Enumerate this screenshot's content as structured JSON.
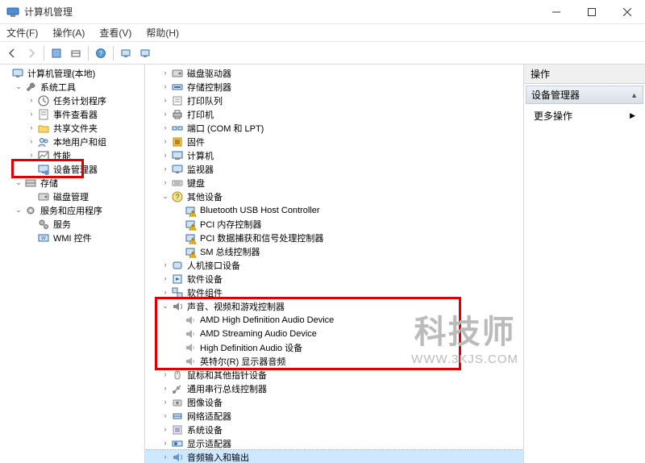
{
  "window": {
    "title": "计算机管理"
  },
  "menubar": [
    "文件(F)",
    "操作(A)",
    "查看(V)",
    "帮助(H)"
  ],
  "left_tree": [
    {
      "d": 0,
      "ex": "",
      "icon": "monitor",
      "label": "计算机管理(本地)"
    },
    {
      "d": 1,
      "ex": "v",
      "icon": "wrench",
      "label": "系统工具"
    },
    {
      "d": 2,
      "ex": ">",
      "icon": "clock",
      "label": "任务计划程序"
    },
    {
      "d": 2,
      "ex": ">",
      "icon": "event",
      "label": "事件查看器"
    },
    {
      "d": 2,
      "ex": ">",
      "icon": "folder",
      "label": "共享文件夹"
    },
    {
      "d": 2,
      "ex": ">",
      "icon": "users",
      "label": "本地用户和组"
    },
    {
      "d": 2,
      "ex": ">",
      "icon": "perf",
      "label": "性能"
    },
    {
      "d": 2,
      "ex": "",
      "icon": "device",
      "label": "设备管理器",
      "boxed": true
    },
    {
      "d": 1,
      "ex": "v",
      "icon": "storage",
      "label": "存储"
    },
    {
      "d": 2,
      "ex": "",
      "icon": "disk",
      "label": "磁盘管理"
    },
    {
      "d": 1,
      "ex": "v",
      "icon": "gear",
      "label": "服务和应用程序"
    },
    {
      "d": 2,
      "ex": "",
      "icon": "gear2",
      "label": "服务"
    },
    {
      "d": 2,
      "ex": "",
      "icon": "wmi",
      "label": "WMI 控件"
    }
  ],
  "device_tree": [
    {
      "d": 0,
      "ex": ">",
      "icon": "disk",
      "label": "磁盘驱动器"
    },
    {
      "d": 0,
      "ex": ">",
      "icon": "scsi",
      "label": "存储控制器"
    },
    {
      "d": 0,
      "ex": ">",
      "icon": "queue",
      "label": "打印队列"
    },
    {
      "d": 0,
      "ex": ">",
      "icon": "printer",
      "label": "打印机"
    },
    {
      "d": 0,
      "ex": ">",
      "icon": "port",
      "label": "端口 (COM 和 LPT)"
    },
    {
      "d": 0,
      "ex": ">",
      "icon": "fw",
      "label": "固件"
    },
    {
      "d": 0,
      "ex": ">",
      "icon": "pc",
      "label": "计算机"
    },
    {
      "d": 0,
      "ex": ">",
      "icon": "monitor",
      "label": "监视器"
    },
    {
      "d": 0,
      "ex": ">",
      "icon": "kbd",
      "label": "键盘"
    },
    {
      "d": 0,
      "ex": "v",
      "icon": "other",
      "label": "其他设备"
    },
    {
      "d": 1,
      "ex": "",
      "icon": "warn",
      "label": "Bluetooth USB Host Controller"
    },
    {
      "d": 1,
      "ex": "",
      "icon": "warn",
      "label": "PCI 内存控制器"
    },
    {
      "d": 1,
      "ex": "",
      "icon": "warn",
      "label": "PCI 数据捕获和信号处理控制器"
    },
    {
      "d": 1,
      "ex": "",
      "icon": "warn",
      "label": "SM 总线控制器"
    },
    {
      "d": 0,
      "ex": ">",
      "icon": "hid",
      "label": "人机接口设备"
    },
    {
      "d": 0,
      "ex": ">",
      "icon": "sw",
      "label": "软件设备"
    },
    {
      "d": 0,
      "ex": ">",
      "icon": "swc",
      "label": "软件组件"
    },
    {
      "d": 0,
      "ex": "v",
      "icon": "audio",
      "label": "声音、视频和游戏控制器",
      "group_boxed": true
    },
    {
      "d": 1,
      "ex": "",
      "icon": "spk",
      "label": "AMD High Definition Audio Device"
    },
    {
      "d": 1,
      "ex": "",
      "icon": "spk",
      "label": "AMD Streaming Audio Device"
    },
    {
      "d": 1,
      "ex": "",
      "icon": "spk",
      "label": "High Definition Audio 设备"
    },
    {
      "d": 1,
      "ex": "",
      "icon": "spk",
      "label": "英特尔(R) 显示器音频"
    },
    {
      "d": 0,
      "ex": ">",
      "icon": "mouse",
      "label": "鼠标和其他指针设备"
    },
    {
      "d": 0,
      "ex": ">",
      "icon": "usb",
      "label": "通用串行总线控制器"
    },
    {
      "d": 0,
      "ex": ">",
      "icon": "cam",
      "label": "图像设备"
    },
    {
      "d": 0,
      "ex": ">",
      "icon": "net",
      "label": "网络适配器"
    },
    {
      "d": 0,
      "ex": ">",
      "icon": "sys",
      "label": "系统设备"
    },
    {
      "d": 0,
      "ex": ">",
      "icon": "gpu",
      "label": "显示适配器"
    },
    {
      "d": 0,
      "ex": ">",
      "icon": "aio",
      "label": "音频输入和输出",
      "selected": true
    }
  ],
  "action_pane": {
    "title": "操作",
    "category": "设备管理器",
    "item": "更多操作"
  },
  "watermark": {
    "cn": "科技师",
    "en": "WWW.3KJS.COM"
  }
}
